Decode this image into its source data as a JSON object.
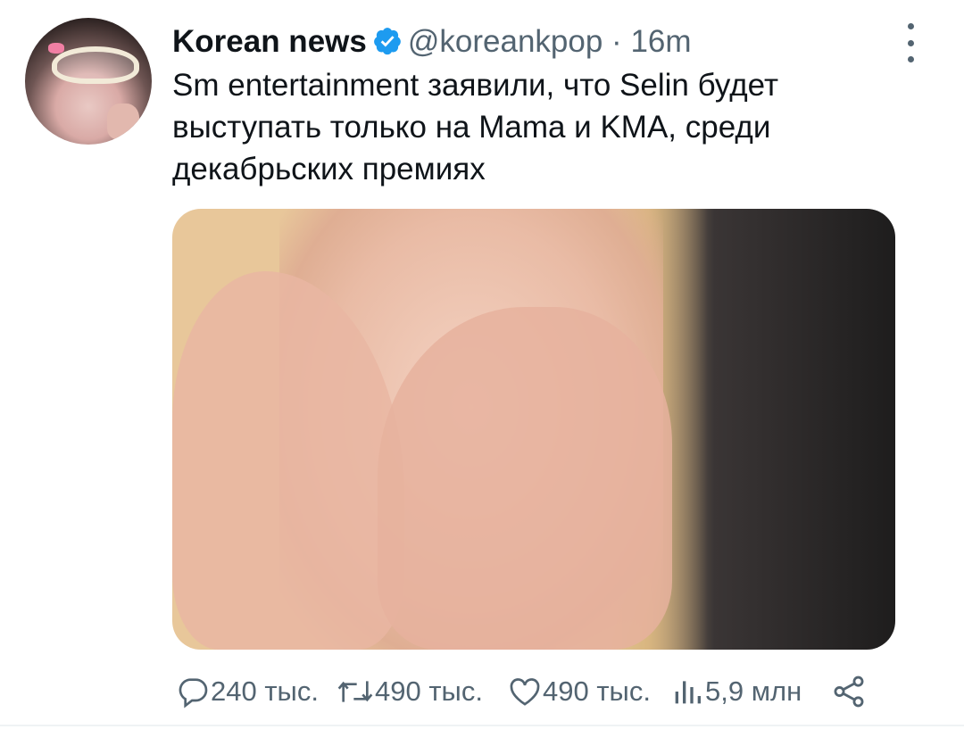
{
  "tweet": {
    "author_name": "Korean news",
    "handle": "@koreankpop",
    "separator": "·",
    "time": "16m",
    "text": "Sm entertainment заявили, что Selin будет выступать только на Mama и KMA, среди декабрьских премиях"
  },
  "actions": {
    "replies": "240 тыс.",
    "retweets": "490 тыс.",
    "likes": "490 тыс.",
    "views": "5,9 млн"
  },
  "colors": {
    "text": "#0f1419",
    "secondary": "#536471",
    "verified": "#1d9bf0"
  },
  "icons": [
    "verified-icon",
    "more-icon",
    "reply-icon",
    "retweet-icon",
    "like-icon",
    "views-icon",
    "share-icon"
  ]
}
